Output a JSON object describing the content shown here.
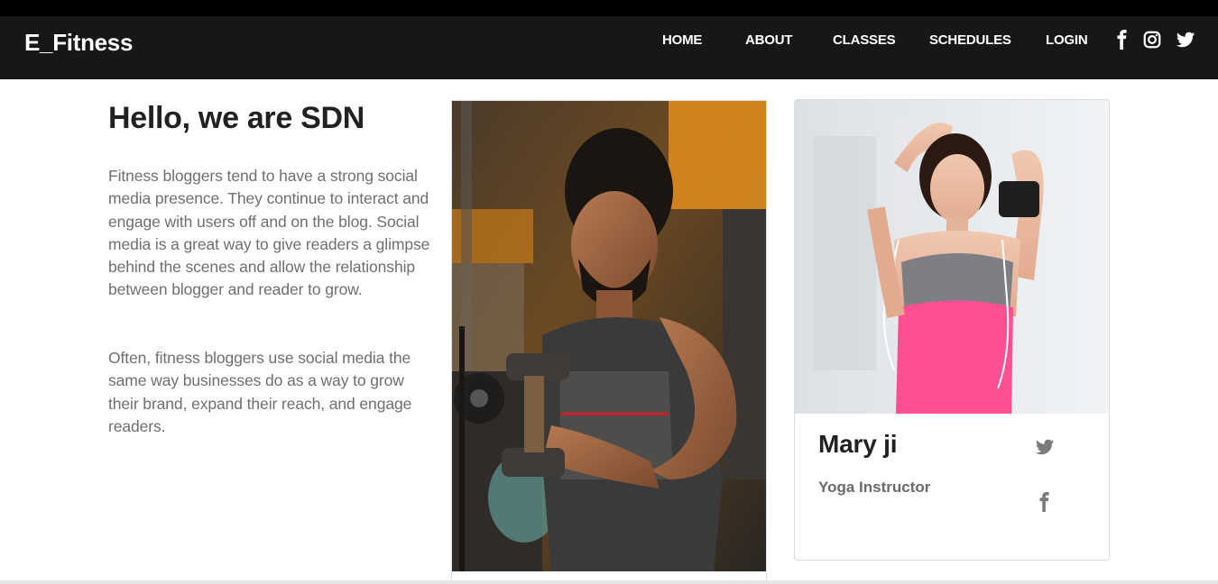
{
  "brand": "E_Fitness",
  "nav": {
    "home": "HOME",
    "about": "ABOUT",
    "classes": "CLASSES",
    "schedules": "SCHEDULES",
    "login": "LOGIN",
    "social_icons": [
      "facebook-icon",
      "instagram-icon",
      "twitter-icon"
    ]
  },
  "hero": {
    "title": "Hello, we are SDN",
    "paragraphs": [
      "Fitness bloggers tend to have a strong social media presence. They continue to interact and engage with users off and on the blog. Social media is a great way to give readers a glimpse behind the scenes and allow the relationship between blogger and reader to grow.",
      "Often, fitness bloggers use social media the same way businesses do as a way to grow their brand, expand their reach, and engage readers."
    ]
  },
  "trainer": {
    "name": "Mary ji",
    "role": "Yoga Instructor",
    "social_icons": [
      "twitter-icon",
      "facebook-icon"
    ]
  },
  "colors": {
    "navbar": "#171717",
    "heading": "#212121",
    "body_text": "#6f6f6f",
    "icon_gray": "#7a7a7a",
    "accent_pink": "#ff4f93"
  }
}
